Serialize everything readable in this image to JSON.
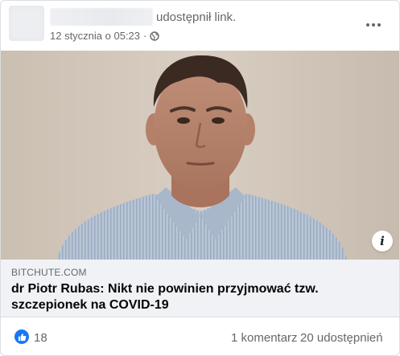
{
  "post": {
    "author_name": "",
    "action": "udostępnił link.",
    "timestamp": "12 stycznia o 05:23",
    "separator": "·"
  },
  "link": {
    "domain": "BITCHUTE.COM",
    "title": "dr Piotr Rubas: Nikt nie powinien przyjmować tzw. szczepionek na COVID-19",
    "info_label": "i"
  },
  "stats": {
    "likes": "18",
    "comments": "1 komentarz",
    "shares": "20 udostępnień"
  },
  "icons": {
    "privacy": "globe-icon",
    "menu": "more-options-icon",
    "reaction": "like-thumb-icon"
  },
  "colors": {
    "brand": "#1877f2",
    "secondary_text": "#65676b",
    "link_bg": "#f0f2f5"
  }
}
